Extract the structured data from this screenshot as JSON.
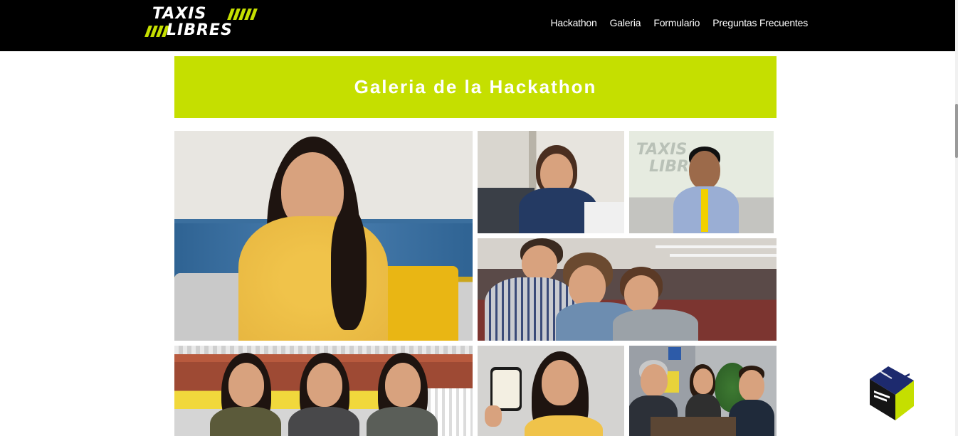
{
  "header": {
    "logo": {
      "line1": "TAXIS",
      "line2": "LIBRES"
    },
    "nav": [
      {
        "label": "Hackathon"
      },
      {
        "label": "Galeria"
      },
      {
        "label": "Formulario"
      },
      {
        "label": "Preguntas Frecuentes"
      }
    ]
  },
  "banner": {
    "title": "Galeria de la Hackathon"
  },
  "gallery": {
    "items": [
      {
        "name": "woman-on-sofa-photo"
      },
      {
        "name": "call-center-agent-photo"
      },
      {
        "name": "man-yellow-tie-photo"
      },
      {
        "name": "team-at-computer-photo"
      },
      {
        "name": "three-women-with-taxi-photo"
      },
      {
        "name": "woman-with-phone-photo"
      },
      {
        "name": "office-meeting-photo"
      }
    ]
  },
  "badge": {
    "icon": "taxis-libres-cube-icon"
  },
  "colors": {
    "brand_green": "#c5df00",
    "header_bg": "#000000"
  }
}
